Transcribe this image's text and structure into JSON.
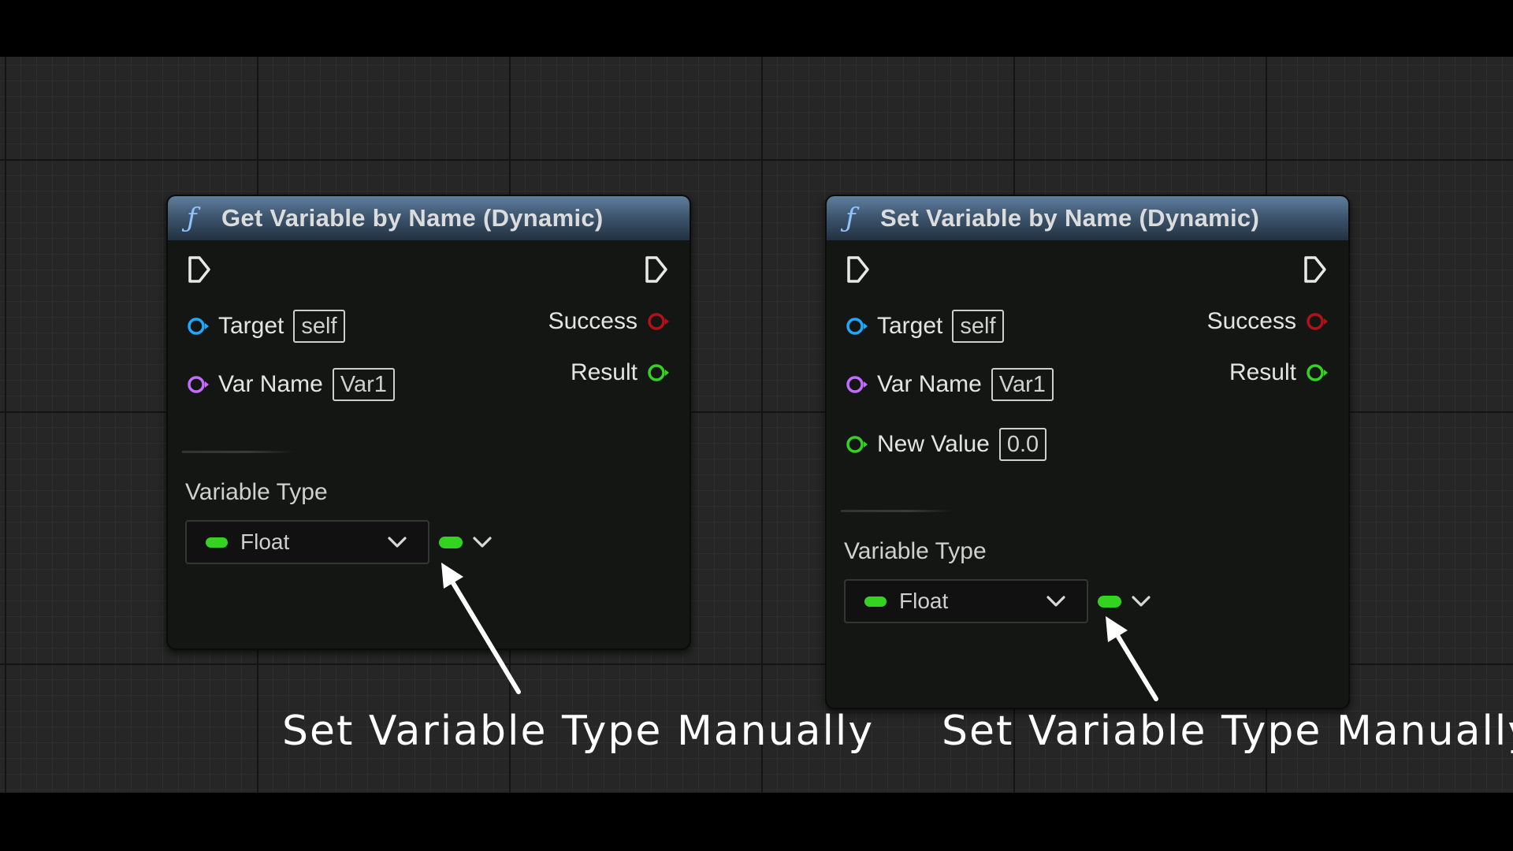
{
  "nodes": [
    {
      "title": "Get Variable by Name (Dynamic)",
      "inputs": [
        {
          "label": "Target",
          "value": "self",
          "pin_color": "#1ea8ff"
        },
        {
          "label": "Var Name",
          "value": "Var1",
          "pin_color": "#c46bff"
        }
      ],
      "outputs": [
        {
          "label": "Success",
          "pin_color": "#b3101a"
        },
        {
          "label": "Result",
          "pin_color": "#35d321"
        }
      ],
      "variable_type_label": "Variable Type",
      "variable_type_value": "Float"
    },
    {
      "title": "Set Variable by Name (Dynamic)",
      "inputs": [
        {
          "label": "Target",
          "value": "self",
          "pin_color": "#1ea8ff"
        },
        {
          "label": "Var Name",
          "value": "Var1",
          "pin_color": "#c46bff"
        },
        {
          "label": "New Value",
          "value": "0.0",
          "pin_color": "#35d321"
        }
      ],
      "outputs": [
        {
          "label": "Success",
          "pin_color": "#b3101a"
        },
        {
          "label": "Result",
          "pin_color": "#35d321"
        }
      ],
      "variable_type_label": "Variable Type",
      "variable_type_value": "Float"
    }
  ],
  "annotations": [
    {
      "text": "Set Variable Type Manually"
    },
    {
      "text": "Set Variable Type Manually"
    }
  ],
  "icons": {
    "function": "function-icon",
    "exec": "exec-pin-icon",
    "dropdown": "chevron-down-icon",
    "type_pill": "float-type-pill-icon"
  }
}
